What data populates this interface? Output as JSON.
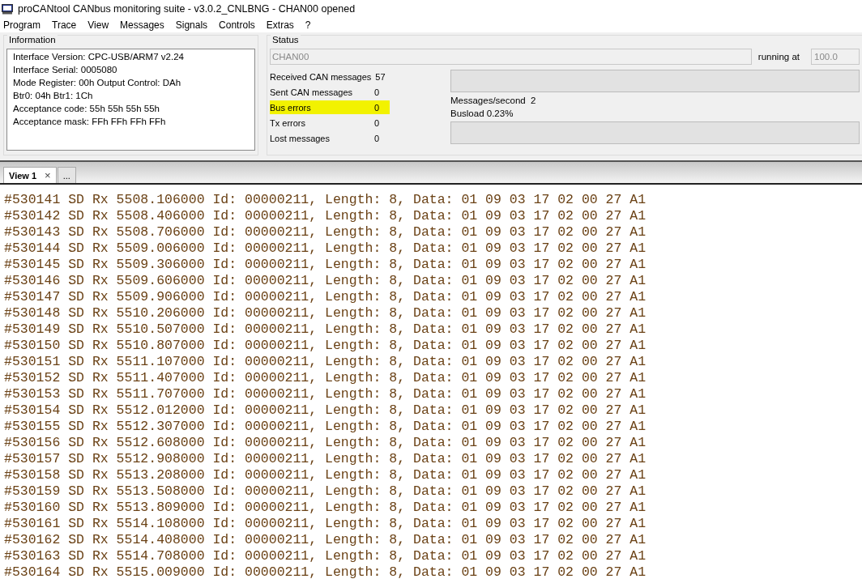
{
  "window": {
    "title": "proCANtool CANbus monitoring suite -  v3.0.2_CNLBNG - CHAN00 opened"
  },
  "menu": [
    "Program",
    "Trace",
    "View",
    "Messages",
    "Signals",
    "Controls",
    "Extras",
    "?"
  ],
  "information": {
    "title": "Information",
    "lines": [
      "Interface Version: CPC-USB/ARM7 v2.24",
      "Interface Serial: 0005080",
      "Mode Register: 00h Output Control: DAh",
      "Btr0: 04h Btr1: 1Ch",
      "Acceptance code: 55h 55h 55h 55h",
      "Acceptance mask: FFh FFh FFh FFh"
    ]
  },
  "status": {
    "title": "Status",
    "channel": "CHAN00",
    "running_at_label": "running at",
    "running_at_value": "100.0",
    "counters": [
      {
        "label": "Received CAN messages",
        "value": "57",
        "highlighted": false
      },
      {
        "label": "Sent CAN messages",
        "value": "0",
        "highlighted": false
      },
      {
        "label": "Bus errors",
        "value": "0",
        "highlighted": true
      },
      {
        "label": "Tx errors",
        "value": "0",
        "highlighted": false
      },
      {
        "label": "Lost messages",
        "value": "0",
        "highlighted": false
      }
    ],
    "messages_bar": {
      "level": 0
    },
    "messages_per_second": "Messages/second  2",
    "busload": "Busload 0.23%",
    "busload_bar": {
      "level": 0
    }
  },
  "tabs": [
    {
      "label": "View 1",
      "close": "×",
      "selected": true
    },
    {
      "label": "...",
      "selected": false
    }
  ],
  "trace": [
    "#530141 SD Rx 5508.106000 Id: 00000211, Length: 8, Data: 01 09 03 17 02 00 27 A1",
    "#530142 SD Rx 5508.406000 Id: 00000211, Length: 8, Data: 01 09 03 17 02 00 27 A1",
    "#530143 SD Rx 5508.706000 Id: 00000211, Length: 8, Data: 01 09 03 17 02 00 27 A1",
    "#530144 SD Rx 5509.006000 Id: 00000211, Length: 8, Data: 01 09 03 17 02 00 27 A1",
    "#530145 SD Rx 5509.306000 Id: 00000211, Length: 8, Data: 01 09 03 17 02 00 27 A1",
    "#530146 SD Rx 5509.606000 Id: 00000211, Length: 8, Data: 01 09 03 17 02 00 27 A1",
    "#530147 SD Rx 5509.906000 Id: 00000211, Length: 8, Data: 01 09 03 17 02 00 27 A1",
    "#530148 SD Rx 5510.206000 Id: 00000211, Length: 8, Data: 01 09 03 17 02 00 27 A1",
    "#530149 SD Rx 5510.507000 Id: 00000211, Length: 8, Data: 01 09 03 17 02 00 27 A1",
    "#530150 SD Rx 5510.807000 Id: 00000211, Length: 8, Data: 01 09 03 17 02 00 27 A1",
    "#530151 SD Rx 5511.107000 Id: 00000211, Length: 8, Data: 01 09 03 17 02 00 27 A1",
    "#530152 SD Rx 5511.407000 Id: 00000211, Length: 8, Data: 01 09 03 17 02 00 27 A1",
    "#530153 SD Rx 5511.707000 Id: 00000211, Length: 8, Data: 01 09 03 17 02 00 27 A1",
    "#530154 SD Rx 5512.012000 Id: 00000211, Length: 8, Data: 01 09 03 17 02 00 27 A1",
    "#530155 SD Rx 5512.307000 Id: 00000211, Length: 8, Data: 01 09 03 17 02 00 27 A1",
    "#530156 SD Rx 5512.608000 Id: 00000211, Length: 8, Data: 01 09 03 17 02 00 27 A1",
    "#530157 SD Rx 5512.908000 Id: 00000211, Length: 8, Data: 01 09 03 17 02 00 27 A1",
    "#530158 SD Rx 5513.208000 Id: 00000211, Length: 8, Data: 01 09 03 17 02 00 27 A1",
    "#530159 SD Rx 5513.508000 Id: 00000211, Length: 8, Data: 01 09 03 17 02 00 27 A1",
    "#530160 SD Rx 5513.809000 Id: 00000211, Length: 8, Data: 01 09 03 17 02 00 27 A1",
    "#530161 SD Rx 5514.108000 Id: 00000211, Length: 8, Data: 01 09 03 17 02 00 27 A1",
    "#530162 SD Rx 5514.408000 Id: 00000211, Length: 8, Data: 01 09 03 17 02 00 27 A1",
    "#530163 SD Rx 5514.708000 Id: 00000211, Length: 8, Data: 01 09 03 17 02 00 27 A1",
    "#530164 SD Rx 5515.009000 Id: 00000211, Length: 8, Data: 01 09 03 17 02 00 27 A1"
  ]
}
